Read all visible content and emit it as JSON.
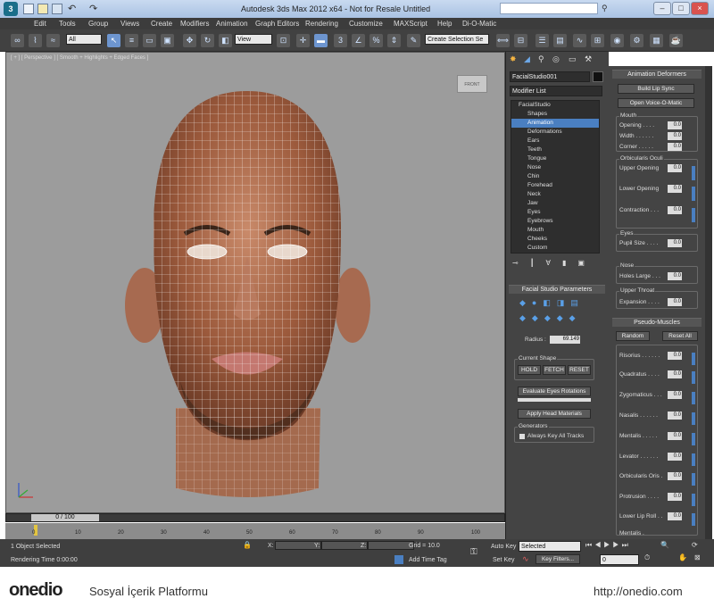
{
  "window": {
    "title": "Autodesk 3ds Max  2012 x64   -  Not for Resale    Untitled"
  },
  "menu": [
    "Edit",
    "Tools",
    "Group",
    "Views",
    "Create",
    "Modifiers",
    "Animation",
    "Graph Editors",
    "Rendering",
    "Customize",
    "MAXScript",
    "Help",
    "Di-O-Matic"
  ],
  "toolbar": {
    "selection_filter": "All",
    "ref_coord": "View",
    "named_selection": "Create Selection Se",
    "snap_value": "3"
  },
  "viewport": {
    "label": "[ + ] [ Perspective ] [ Smooth + Highlights + Edged Faces ]",
    "viewcube": "FRONT"
  },
  "timeline": {
    "slider": "0 / 100",
    "ticks": [
      "0",
      "10",
      "20",
      "30",
      "40",
      "50",
      "60",
      "70",
      "80",
      "90",
      "100"
    ]
  },
  "status": {
    "selected": "1 Object Selected",
    "render_time": "Rendering Time  0:00:00",
    "x_label": "X:",
    "y_label": "Y:",
    "z_label": "Z:",
    "grid": "Grid = 10.0",
    "add_time_tag": "Add Time Tag",
    "auto_key": "Auto Key",
    "set_key": "Set Key",
    "key_mode": "Selected",
    "key_filters": "Key Filters...",
    "frame": "0"
  },
  "command_panel": {
    "object_name": "FacialStudio001",
    "modifier_list": "Modifier List",
    "stack": [
      "FacialStudio",
      "Shapes",
      "Animation",
      "Deformations",
      "Ears",
      "Teeth",
      "Tongue",
      "Nose",
      "Chin",
      "Forehead",
      "Neck",
      "Jaw",
      "Eyes",
      "Eyebrows",
      "Mouth",
      "Cheeks",
      "Custom"
    ],
    "params_title": "Facial Studio Parameters",
    "radius_label": "Radius :",
    "radius_value": "69.149",
    "current_shape": "Current Shape",
    "hold": "HOLD",
    "fetch": "FETCH",
    "reset": "RESET",
    "eval_eyes": "Evaluate Eyes Rotations",
    "apply_head": "Apply Head Materials",
    "generators": "Generators",
    "always_key": "Always Key All Tracks"
  },
  "right_panel": {
    "anim_deformers": "Animation Deformers",
    "build_lip": "Build Lip Sync",
    "open_voice": "Open Voice-O-Matic",
    "mouth": "Mouth",
    "mouth_params": [
      "Opening . . . .",
      "Width . . . . . .",
      "Corner . . . . ."
    ],
    "orbicularis": "Orbicularis Oculi",
    "orb_params": [
      "Upper Opening",
      "Lower Opening",
      "Contraction . . ."
    ],
    "eyes": "Eyes",
    "pupil": "Pupil Size . . . .",
    "nose": "Nose",
    "holes": "Holes Large . . .",
    "upper_throat": "Upper Throat",
    "expansion": "Expansion . . . .",
    "pseudo": "Pseudo-Muscles",
    "random": "Random",
    "reset_all": "Reset All",
    "muscles": [
      "Risorius . . . . . .",
      "Quadratus . . . .",
      "Zygomaticus . . .",
      "Nasalis . . . . . .",
      "Mentalis . . . . .",
      "Levator . . . . . .",
      "Orbicularis Oris .",
      "Protrusion . . . .",
      "Lower Lip Roll . .",
      "Mentalis ."
    ],
    "value": "0.0"
  },
  "footer": {
    "brand": "onedio",
    "tagline": "Sosyal İçerik Platformu",
    "url": "http://onedio.com"
  }
}
